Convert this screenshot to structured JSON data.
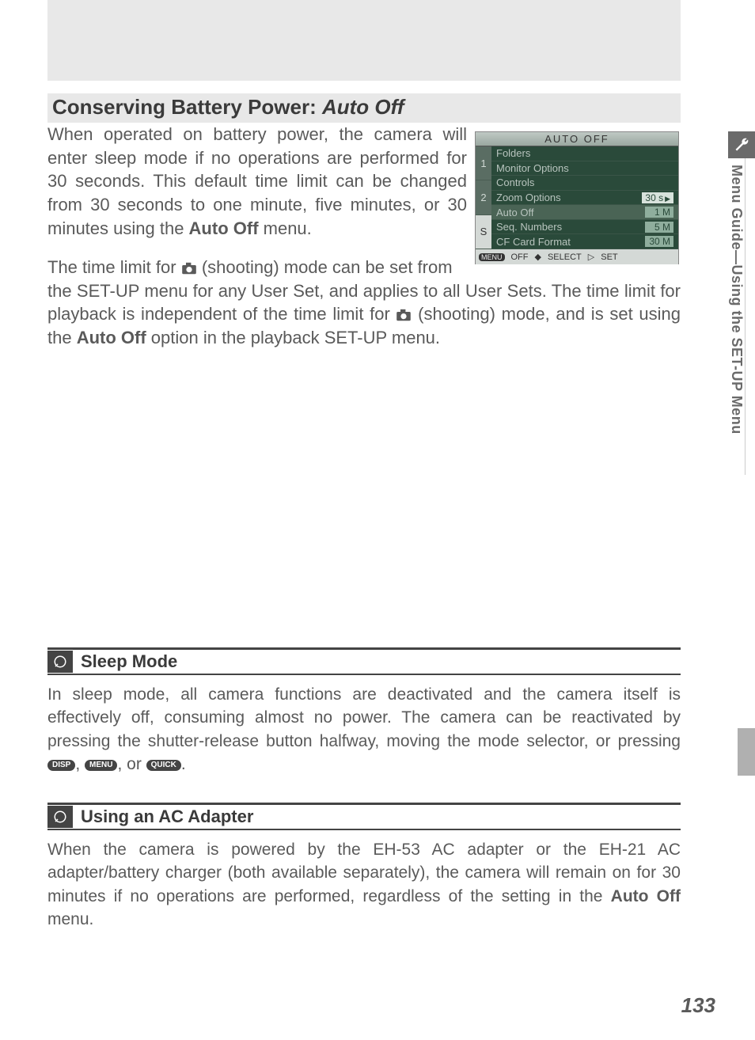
{
  "section": {
    "title_prefix": "Conserving Battery Power: ",
    "title_em": "Auto Off"
  },
  "para1_parts": {
    "p1": "When operated on battery power, the camera will enter sleep mode if no operations are performed for 30 seconds. This default time limit can be changed from 30 seconds to one minute, five minutes, or 30 minutes using the ",
    "b1": "Auto Off",
    "p2": " menu."
  },
  "para2_parts": {
    "line1_a": "The time limit for ",
    "line1_b": " (shooting) mode can be set from",
    "rest_a": "the SET-UP menu for any User Set, and applies to all User Sets. The time limit for playback is independent of the time limit for ",
    "rest_b": " (shooting) mode, and is set using the ",
    "rest_bold": "Auto Off",
    "rest_c": " option in the playback SET-UP menu."
  },
  "menu": {
    "title": "AUTO OFF",
    "sidebar": [
      "1",
      "2",
      "S"
    ],
    "items": [
      {
        "label": "Folders",
        "value": ""
      },
      {
        "label": "Monitor Options",
        "value": ""
      },
      {
        "label": "Controls",
        "value": ""
      },
      {
        "label": "Zoom Options",
        "value": "30 s",
        "selected_val": true
      },
      {
        "label": "Auto Off",
        "value": "1 M",
        "selected_row": true
      },
      {
        "label": "Seq. Numbers",
        "value": "5 M"
      },
      {
        "label": "CF Card Format",
        "value": "30 M"
      }
    ],
    "footer": {
      "btn1": "MENU",
      "t1": "OFF",
      "sel_icon": "◆",
      "t2": "SELECT",
      "set_icon": "▷",
      "t3": " SET"
    }
  },
  "sidetab": "Menu Guide—Using the SET-UP Menu",
  "callouts": [
    {
      "title": "Sleep Mode",
      "body_a": "In sleep mode, all camera functions are deactivated and the camera itself is effectively off, consuming almost no power. The camera can be reactivated by pressing the shutter-release button halfway, moving the mode selector, or pressing ",
      "pill1": "DISP",
      "sep1": ", ",
      "pill2": "MENU",
      "sep2": ", or ",
      "pill3": "QUICK",
      "body_b": "."
    },
    {
      "title": "Using an AC Adapter",
      "body_a": "When the camera is powered by the EH-53 AC adapter or the EH-21 AC adapter/battery charger (both available separately), the camera will remain on for 30 minutes if no operations are performed, regardless of the setting in the ",
      "bold": "Auto Off",
      "body_b": " menu."
    }
  ],
  "page_number": "133"
}
